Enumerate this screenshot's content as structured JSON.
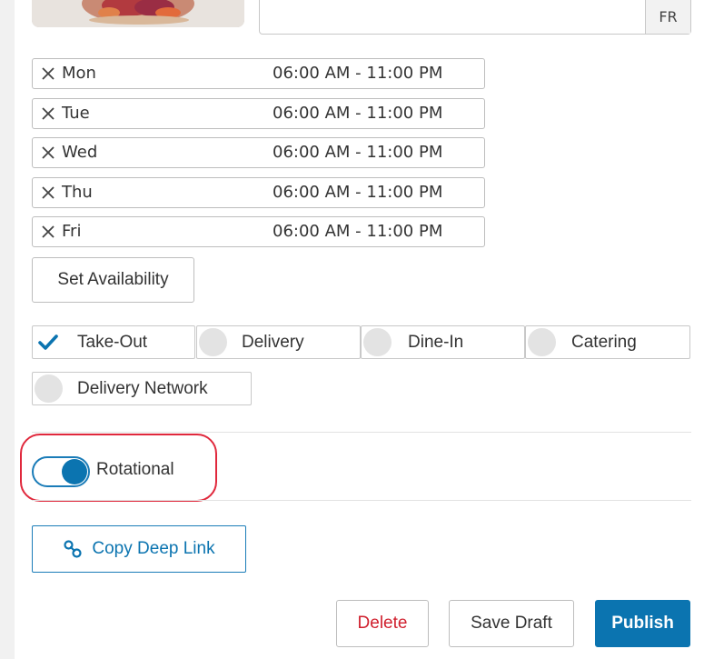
{
  "language": {
    "code": "FR",
    "value": ""
  },
  "hours": [
    {
      "day": "Mon",
      "range": "06:00 AM - 11:00 PM"
    },
    {
      "day": "Tue",
      "range": "06:00 AM - 11:00 PM"
    },
    {
      "day": "Wed",
      "range": "06:00 AM - 11:00 PM"
    },
    {
      "day": "Thu",
      "range": "06:00 AM - 11:00 PM"
    },
    {
      "day": "Fri",
      "range": "06:00 AM - 11:00 PM"
    }
  ],
  "set_availability_label": "Set Availability",
  "order_types": [
    {
      "label": "Take-Out",
      "checked": true
    },
    {
      "label": "Delivery",
      "checked": false
    },
    {
      "label": "Dine-In",
      "checked": false
    },
    {
      "label": "Catering",
      "checked": false
    },
    {
      "label": "Delivery Network",
      "checked": false
    }
  ],
  "rotational": {
    "label": "Rotational",
    "enabled": true
  },
  "deep_link_label": "Copy Deep Link",
  "actions": {
    "delete": "Delete",
    "save_draft": "Save Draft",
    "publish": "Publish"
  },
  "colors": {
    "accent": "#0b74b0",
    "danger": "#d0202e",
    "highlight": "#e0283c"
  },
  "icons": {
    "remove": "close-icon",
    "check": "checkmark-icon",
    "link": "link-icon"
  }
}
